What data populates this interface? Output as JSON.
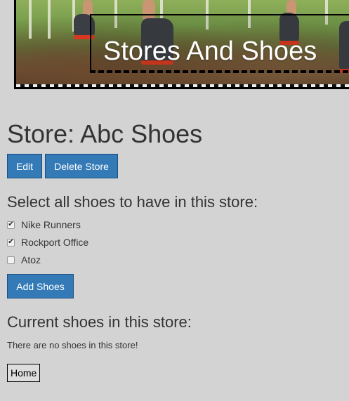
{
  "banner": {
    "title": "Stores And Shoes"
  },
  "store": {
    "heading": "Store: Abc Shoes"
  },
  "actions": {
    "edit_label": "Edit",
    "delete_label": "Delete Store"
  },
  "select_section": {
    "heading": "Select all shoes to have in this store:",
    "options": [
      {
        "label": "Nike Runners",
        "checked": true
      },
      {
        "label": "Rockport Office",
        "checked": true
      },
      {
        "label": "Atoz",
        "checked": false
      }
    ],
    "add_label": "Add Shoes"
  },
  "current_section": {
    "heading": "Current shoes in this store:",
    "empty_message": "There are no shoes in this store!"
  },
  "footer": {
    "home_label": "Home"
  },
  "colors": {
    "primary": "#337ab7",
    "background": "#d3d3d3"
  }
}
